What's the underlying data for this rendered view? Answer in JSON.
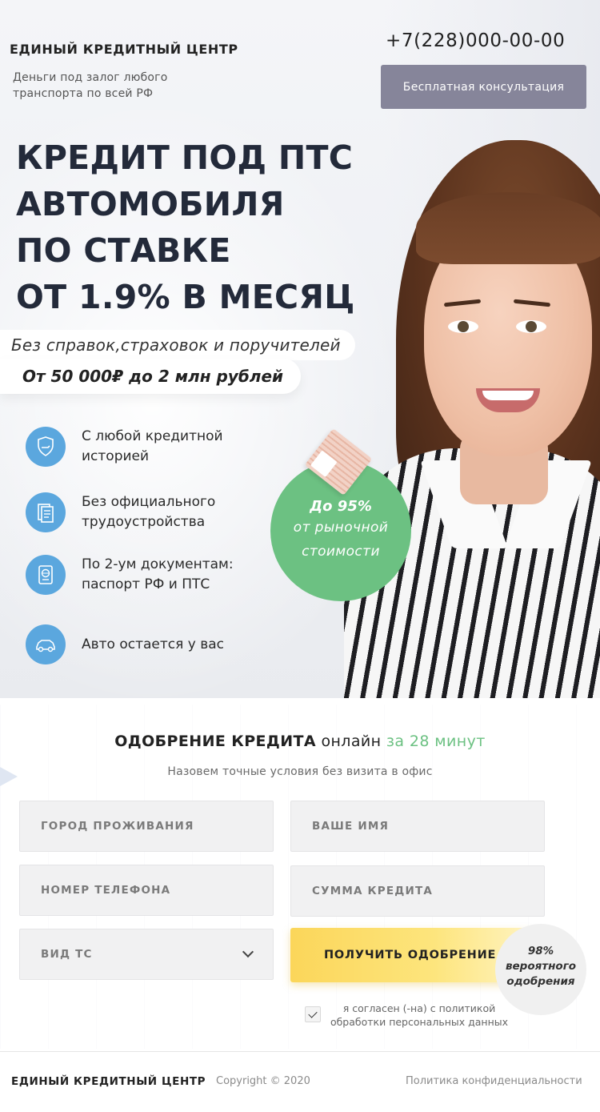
{
  "header": {
    "brand": "ЕДИНЫЙ КРЕДИТНЫЙ ЦЕНТР",
    "tagline": "Деньги под залог любого транспорта по всей РФ",
    "phone": "+7(228)000-00-00",
    "consult_button": "Бесплатная консультация"
  },
  "hero": {
    "headline": [
      "КРЕДИТ ПОД ПТС",
      "АВТОМОБИЛЯ",
      "ПО СТАВКЕ",
      "ОТ 1.9% В МЕСЯЦ"
    ],
    "pill_1": "Без справок,страховок и поручителей",
    "pill_2": "От 50 000₽ до 2 млн рублей",
    "features": [
      {
        "icon": "shield-hand-icon",
        "text": "С любой кредитной историей"
      },
      {
        "icon": "documents-icon",
        "text": "Без официального трудоустройства"
      },
      {
        "icon": "passport-icon",
        "text": "По 2-ум документам: паспорт РФ и ПТС"
      },
      {
        "icon": "car-icon",
        "text": "Авто остается у вас"
      }
    ],
    "badge": {
      "line1": "До 95%",
      "line2": "от рыночной",
      "line3": "стоимости"
    }
  },
  "form": {
    "title_main": "ОДОБРЕНИЕ КРЕДИТА",
    "title_online": "онлайн",
    "title_time": "за 28 минут",
    "subtitle": "Назовем точные условия без визита в офис",
    "city_placeholder": "ГОРОД ПРОЖИВАНИЯ",
    "name_placeholder": "ВАШЕ ИМЯ",
    "phone_placeholder": "НОМЕР ТЕЛЕФОНА",
    "amount_placeholder": "СУММА КРЕДИТА",
    "vehicle_select": "ВИД ТС",
    "submit_label": "ПОЛУЧИТЬ ОДОБРЕНИЕ",
    "approve_badge": {
      "line1": "98%",
      "line2": "вероятного",
      "line3": "одобрения"
    },
    "agree_text": "я согласен (-на) с политикой обработки персональных данных",
    "agree_checked": true
  },
  "footer": {
    "brand": "ЕДИНЫЙ КРЕДИТНЫЙ ЦЕНТР",
    "copyright": "Copyright © 2020",
    "policy_link": "Политика конфиденциальности"
  },
  "colors": {
    "accent_green": "#6cc182",
    "icon_blue": "#5ba7de",
    "button_gray": "#86859a",
    "submit_yellow": "#fbd65a"
  }
}
